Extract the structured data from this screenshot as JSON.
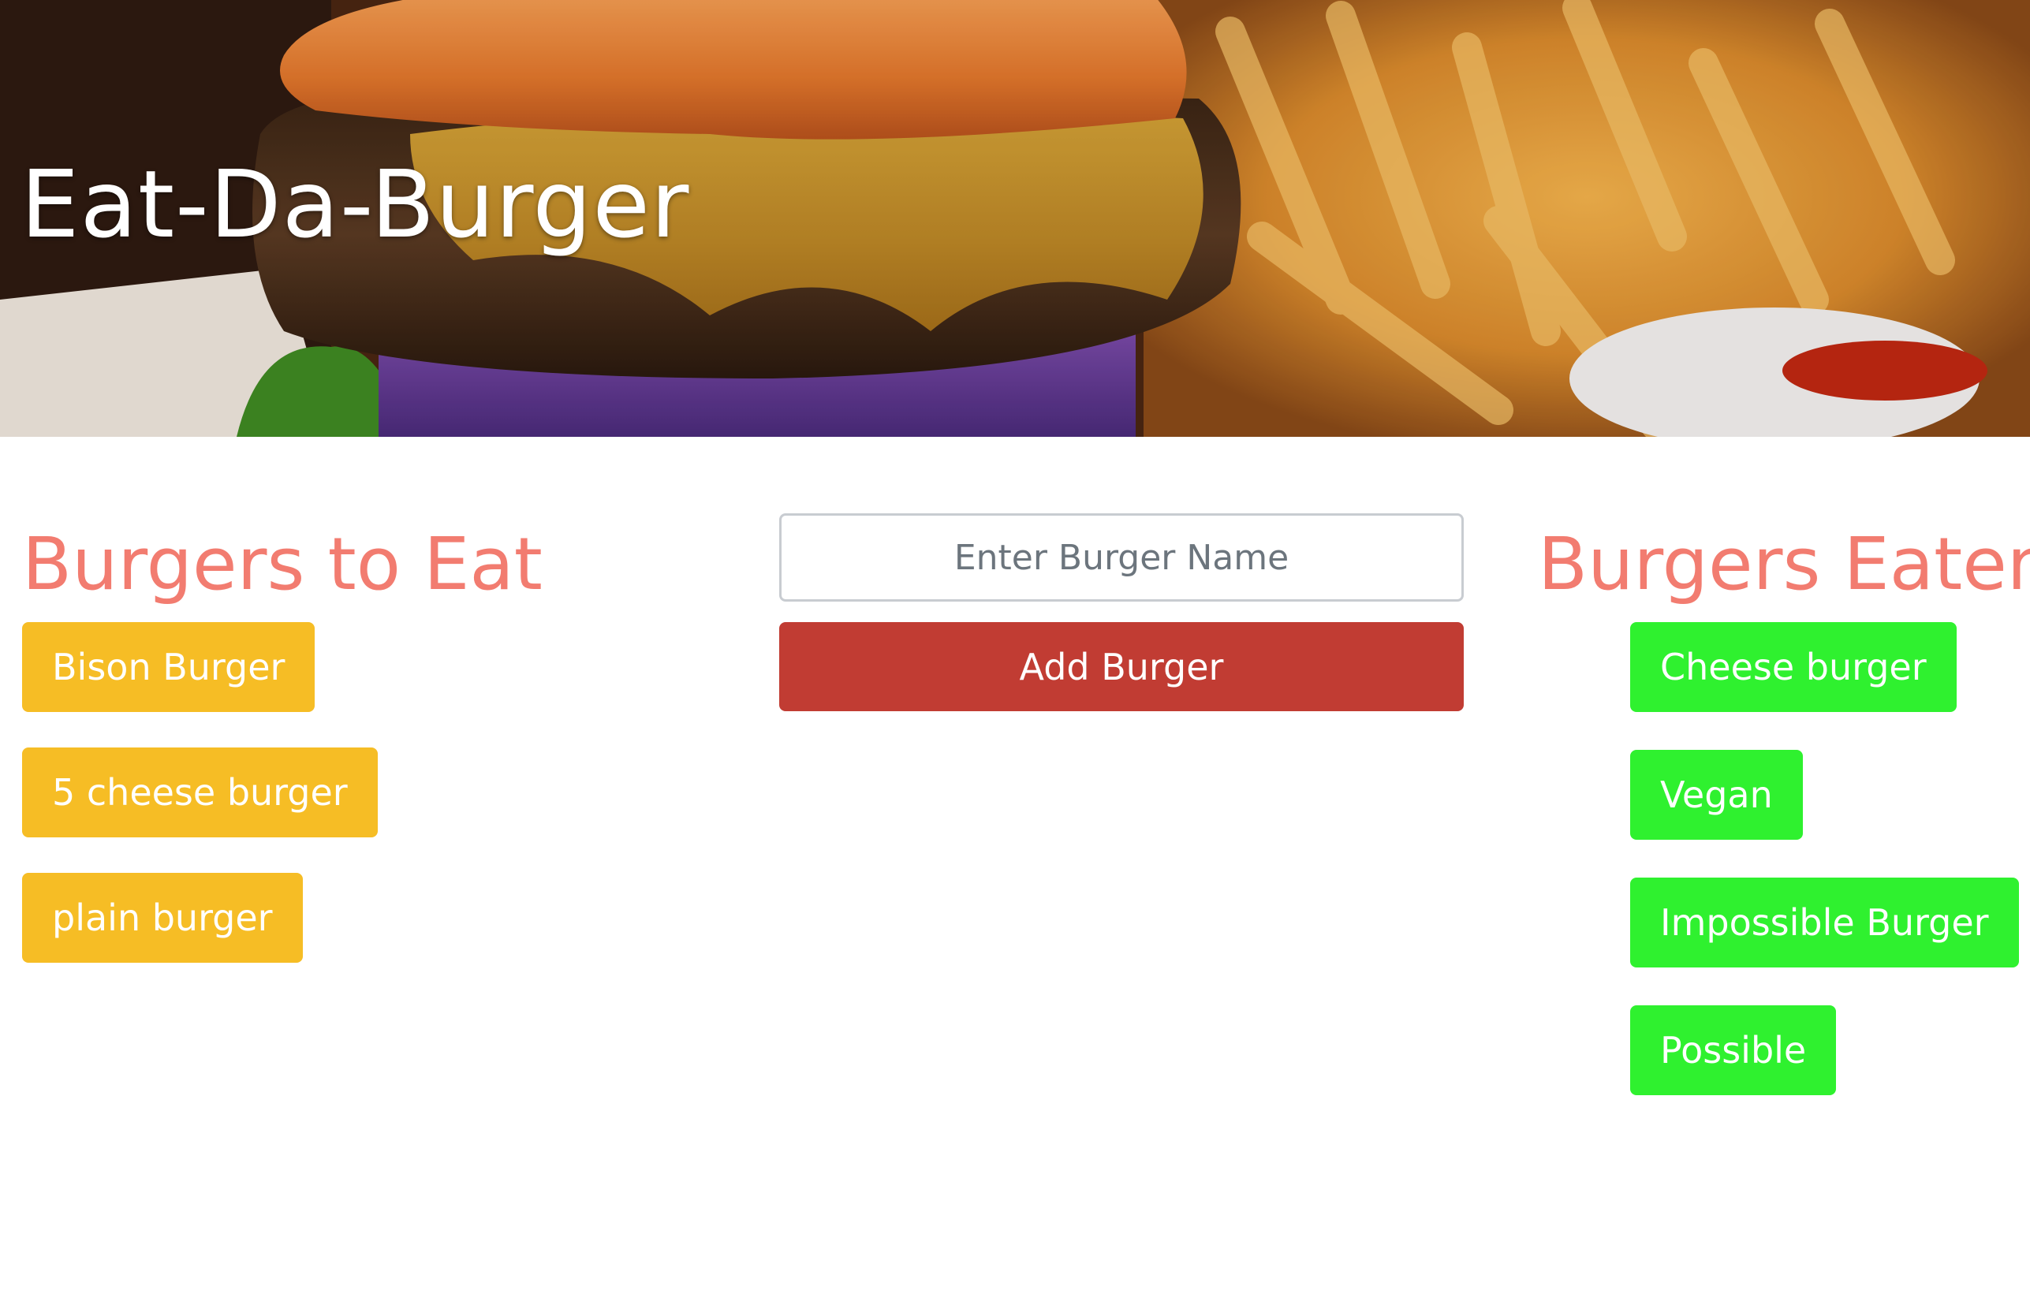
{
  "header": {
    "title": "Eat-Da-Burger",
    "banner_image": "burger-and-fries-photo"
  },
  "to_eat": {
    "heading": "Burgers to Eat",
    "items": [
      "Bison Burger",
      "5 cheese burger",
      "plain burger"
    ],
    "button_color": "#f6bd25"
  },
  "form": {
    "placeholder": "Enter Burger Name",
    "value": "",
    "submit_label": "Add Burger",
    "submit_color": "#c13c33"
  },
  "eaten": {
    "heading": "Burgers Eaten",
    "items": [
      "Cheese burger",
      "Vegan",
      "Impossible Burger",
      "Possible"
    ],
    "button_color": "#2ff12f"
  },
  "colors": {
    "heading": "#f27c70"
  }
}
